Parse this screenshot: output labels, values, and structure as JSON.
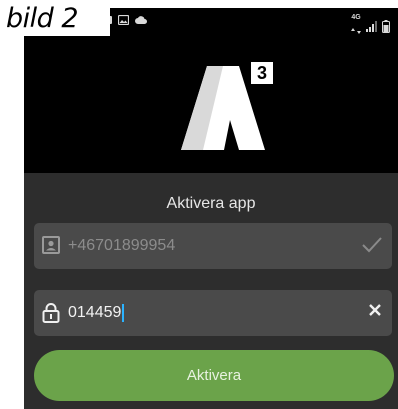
{
  "figure_label": "bild 2",
  "statusbar": {
    "network_label": "4G",
    "icons": [
      "notification-icon",
      "image-icon",
      "cloud-icon",
      "signal-icon",
      "battery-icon"
    ]
  },
  "app": {
    "logo_superscript": "3",
    "title": "Aktivera app"
  },
  "phone_field": {
    "value": "+46701899954",
    "icon": "contact-card-icon",
    "status_icon": "checkmark-icon"
  },
  "code_field": {
    "value": "014459",
    "icon": "padlock-icon",
    "clear_icon": "close-icon"
  },
  "activate_button": {
    "label": "Aktivera"
  },
  "colors": {
    "background": "#000000",
    "panel": "#2d2d2d",
    "field": "#4a4a4a",
    "button": "#6ba34a",
    "caret": "#2bb3ff"
  }
}
